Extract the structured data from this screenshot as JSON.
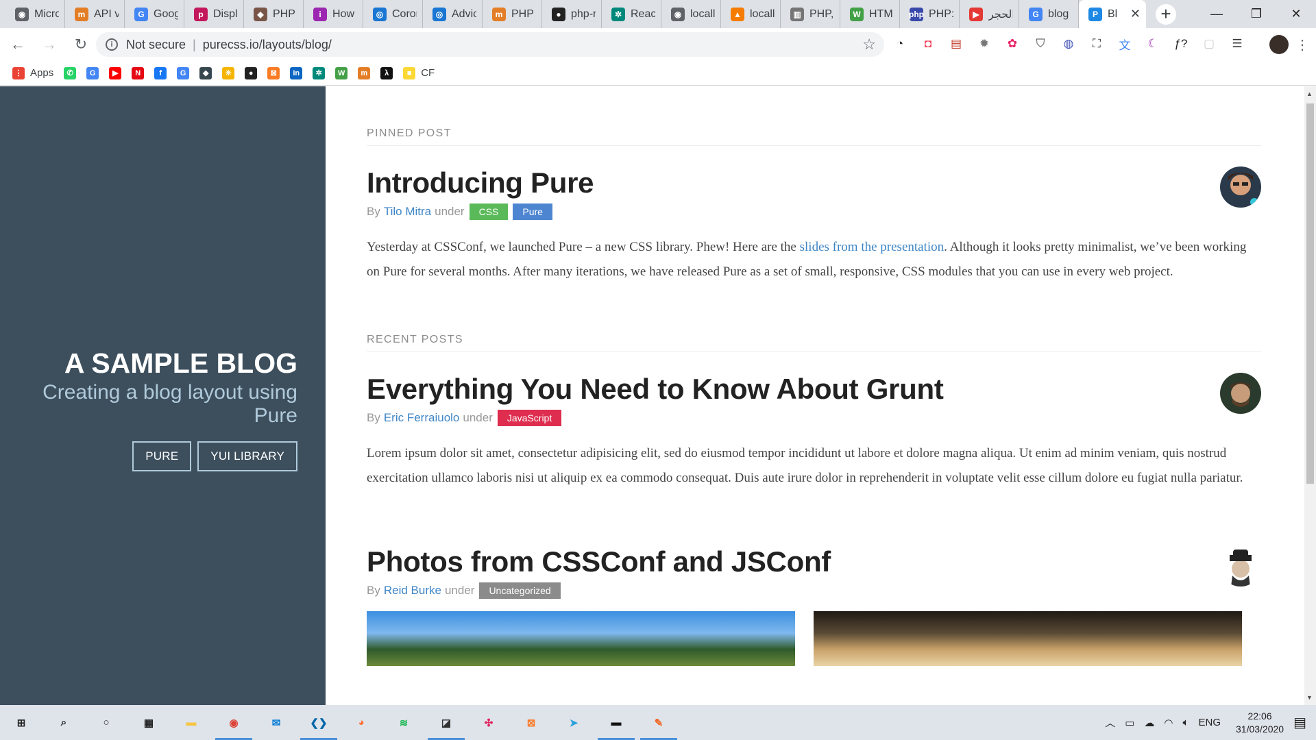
{
  "browser": {
    "tabs": [
      {
        "label": "Micro",
        "color": "#5f6368",
        "glyph": "◉"
      },
      {
        "label": "API v",
        "color": "#e37e26",
        "glyph": "m"
      },
      {
        "label": "Goog",
        "color": "#4285f4",
        "glyph": "G"
      },
      {
        "label": "Displ",
        "color": "#c2185b",
        "glyph": "p"
      },
      {
        "label": "PHP",
        "color": "#795548",
        "glyph": "◆"
      },
      {
        "label": "How",
        "color": "#9c27b0",
        "glyph": "i"
      },
      {
        "label": "Coron",
        "color": "#1976d2",
        "glyph": "◎"
      },
      {
        "label": "Advic",
        "color": "#1976d2",
        "glyph": "◎"
      },
      {
        "label": "PHP v",
        "color": "#e37e26",
        "glyph": "m"
      },
      {
        "label": "php-r",
        "color": "#222222",
        "glyph": "●"
      },
      {
        "label": "React",
        "color": "#00897b",
        "glyph": "✲"
      },
      {
        "label": "locall",
        "color": "#5f6368",
        "glyph": "◉"
      },
      {
        "label": "locall",
        "color": "#f57c00",
        "glyph": "▲"
      },
      {
        "label": "PHP,",
        "color": "#757575",
        "glyph": "▥"
      },
      {
        "label": "HTM",
        "color": "#43a047",
        "glyph": "W"
      },
      {
        "label": "PHP:",
        "color": "#3949ab",
        "glyph": "php"
      },
      {
        "label": "الحجر",
        "color": "#e53935",
        "glyph": "▶"
      },
      {
        "label": "blog",
        "color": "#4285f4",
        "glyph": "G"
      },
      {
        "label": "Bl",
        "color": "#1e88e5",
        "glyph": "P",
        "active": true
      }
    ],
    "new_tab": "+",
    "address": {
      "security": "Not secure",
      "url": "purecss.io/layouts/blog/"
    },
    "bookmarks": [
      {
        "label": "Apps",
        "color": "#ea4335",
        "glyph": "⋮"
      },
      {
        "label": "",
        "color": "#25d366",
        "glyph": "✆"
      },
      {
        "label": "",
        "color": "#4285f4",
        "glyph": "G"
      },
      {
        "label": "",
        "color": "#ff0000",
        "glyph": "▶"
      },
      {
        "label": "",
        "color": "#e50914",
        "glyph": "N"
      },
      {
        "label": "",
        "color": "#1877f2",
        "glyph": "f"
      },
      {
        "label": "",
        "color": "#4285f4",
        "glyph": "G"
      },
      {
        "label": "",
        "color": "#37474f",
        "glyph": "◆"
      },
      {
        "label": "",
        "color": "#f4b400",
        "glyph": "✳"
      },
      {
        "label": "",
        "color": "#222222",
        "glyph": "●"
      },
      {
        "label": "",
        "color": "#fb7a24",
        "glyph": "⊠"
      },
      {
        "label": "",
        "color": "#0a66c2",
        "glyph": "in"
      },
      {
        "label": "",
        "color": "#00897b",
        "glyph": "✲"
      },
      {
        "label": "",
        "color": "#43a047",
        "glyph": "W"
      },
      {
        "label": "",
        "color": "#e37e26",
        "glyph": "m"
      },
      {
        "label": "",
        "color": "#111111",
        "glyph": "λ"
      },
      {
        "label": "CF",
        "color": "#fdd835",
        "glyph": "■"
      }
    ]
  },
  "sidebar": {
    "title": "A Sample Blog",
    "tagline": "Creating a blog layout using Pure",
    "nav": [
      {
        "label": "Pure"
      },
      {
        "label": "YUI Library"
      }
    ]
  },
  "pinned": {
    "heading": "Pinned Post",
    "post": {
      "title": "Introducing Pure",
      "by": "By",
      "author": "Tilo Mitra",
      "under": "under",
      "tags": [
        {
          "label": "CSS",
          "color": "#5aba59"
        },
        {
          "label": "Pure",
          "color": "#4d85d1"
        }
      ],
      "body_before": "Yesterday at CSSConf, we launched Pure – a new CSS library. Phew! Here are the ",
      "body_link": "slides from the presentation",
      "body_after": ". Although it looks pretty minimalist, we’ve been working on Pure for several months. After many iterations, we have released Pure as a set of small, responsive, CSS modules that you can use in every web project."
    }
  },
  "recent": {
    "heading": "Recent Posts",
    "posts": [
      {
        "title": "Everything You Need to Know About Grunt",
        "by": "By",
        "author": "Eric Ferraiuolo",
        "under": "under",
        "tag": "JavaScript",
        "body": "Lorem ipsum dolor sit amet, consectetur adipisicing elit, sed do eiusmod tempor incididunt ut labore et dolore magna aliqua. Ut enim ad minim veniam, quis nostrud exercitation ullamco laboris nisi ut aliquip ex ea commodo consequat. Duis aute irure dolor in reprehenderit in voluptate velit esse cillum dolore eu fugiat nulla pariatur."
      },
      {
        "title": "Photos from CSSConf and JSConf",
        "by": "By",
        "author": "Reid Burke",
        "under": "under",
        "tag": "Uncategorized"
      }
    ]
  },
  "taskbar": {
    "apps": [
      {
        "glyph": "⊞",
        "color": "#222222"
      },
      {
        "glyph": "⌕",
        "color": "#222222"
      },
      {
        "glyph": "○",
        "color": "#222222"
      },
      {
        "glyph": "▦",
        "color": "#222222"
      },
      {
        "glyph": "▬",
        "color": "#f5c542"
      },
      {
        "glyph": "◉",
        "color": "#db4437",
        "active": true
      },
      {
        "glyph": "✉",
        "color": "#0078d4"
      },
      {
        "glyph": "❮❯",
        "color": "#0065a9",
        "active": true
      },
      {
        "glyph": "◕",
        "color": "#ff7139"
      },
      {
        "glyph": "≋",
        "color": "#1db954"
      },
      {
        "glyph": "◪",
        "color": "#333333",
        "active": true
      },
      {
        "glyph": "✣",
        "color": "#e01e5a"
      },
      {
        "glyph": "⊠",
        "color": "#fb7a24"
      },
      {
        "glyph": "➤",
        "color": "#2aa1da"
      },
      {
        "glyph": "▬",
        "color": "#111111",
        "active": true
      },
      {
        "glyph": "✎",
        "color": "#f26522",
        "active": true
      }
    ],
    "tray_lang": "ENG",
    "time": "22:06",
    "date": "31/03/2020"
  }
}
